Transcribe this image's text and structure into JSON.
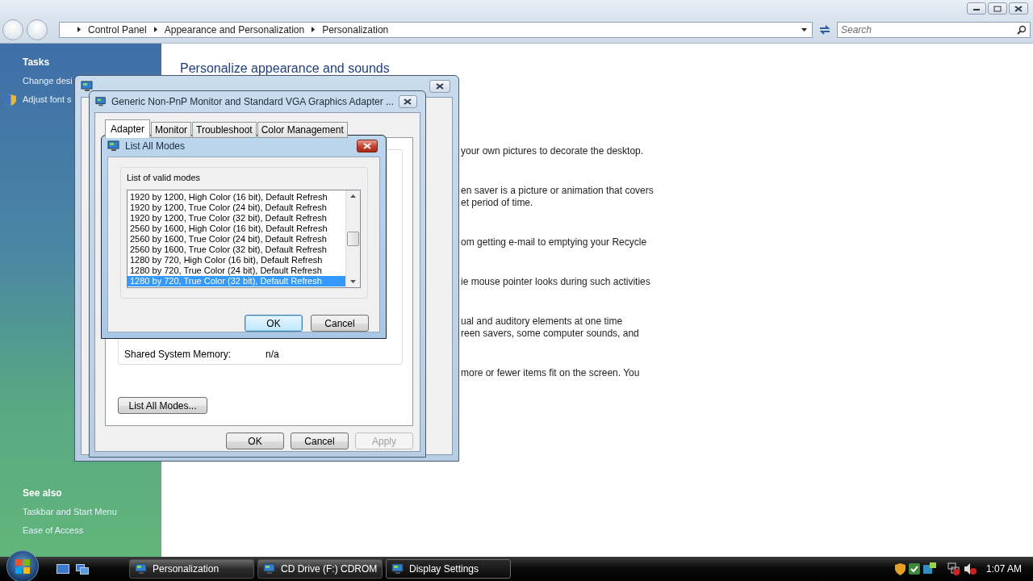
{
  "explorer": {
    "address_bar": {
      "breadcrumbs": [
        "Control Panel",
        "Appearance and Personalization",
        "Personalization"
      ]
    },
    "search": {
      "placeholder": "Search"
    },
    "sidebar": {
      "tasks_heading": "Tasks",
      "tasks": [
        {
          "label": "Change desi",
          "shield": false
        },
        {
          "label": "Adjust font s",
          "shield": true
        }
      ],
      "see_also_heading": "See also",
      "see_also": [
        "Taskbar and Start Menu",
        "Ease of Access"
      ]
    },
    "content": {
      "heading": "Personalize appearance and sounds",
      "descriptions": [
        {
          "lines": [
            "your own pictures to decorate the desktop."
          ]
        },
        {
          "lines": [
            "en saver is a picture or animation that covers",
            "et period of time."
          ]
        },
        {
          "lines": [
            "om getting e-mail to emptying your Recycle"
          ]
        },
        {
          "lines": [
            "ie mouse pointer looks during such activities"
          ]
        },
        {
          "lines": [
            "ual and auditory elements at one time",
            "reen savers, some computer sounds, and"
          ]
        },
        {
          "lines": [
            "more or fewer items fit on the screen. You"
          ]
        }
      ]
    }
  },
  "adapter_window": {
    "title": "Generic Non-PnP Monitor and Standard VGA Graphics Adapter ...",
    "tabs": [
      {
        "label": "Adapter",
        "selected": true
      },
      {
        "label": "Monitor",
        "selected": false
      },
      {
        "label": "Troubleshoot",
        "selected": false
      },
      {
        "label": "Color Management",
        "selected": false
      }
    ],
    "shared_memory": {
      "label": "Shared System Memory:",
      "value": "n/a"
    },
    "list_all_modes_button": "List All Modes...",
    "buttons": [
      {
        "label": "OK",
        "disabled": false
      },
      {
        "label": "Cancel",
        "disabled": false
      },
      {
        "label": "Apply",
        "disabled": true
      }
    ]
  },
  "list_modes_dialog": {
    "title": "List All Modes",
    "group_label": "List of valid modes",
    "modes": [
      {
        "label": "1920 by 1200, High Color (16 bit), Default Refresh",
        "selected": false
      },
      {
        "label": "1920 by 1200, True Color (24 bit), Default Refresh",
        "selected": false
      },
      {
        "label": "1920 by 1200, True Color (32 bit), Default Refresh",
        "selected": false
      },
      {
        "label": "2560 by 1600, High Color (16 bit), Default Refresh",
        "selected": false
      },
      {
        "label": "2560 by 1600, True Color (24 bit), Default Refresh",
        "selected": false
      },
      {
        "label": "2560 by 1600, True Color (32 bit), Default Refresh",
        "selected": false
      },
      {
        "label": "1280 by 720, High Color (16 bit), Default Refresh",
        "selected": false
      },
      {
        "label": "1280 by 720, True Color (24 bit), Default Refresh",
        "selected": false
      },
      {
        "label": "1280 by 720, True Color (32 bit), Default Refresh",
        "selected": true
      }
    ],
    "buttons": [
      {
        "label": "OK",
        "default": true
      },
      {
        "label": "Cancel",
        "default": false
      }
    ]
  },
  "taskbar": {
    "tasks": [
      {
        "label": "Personalization",
        "active": false
      },
      {
        "label": "CD Drive (F:) CDROM",
        "active": false
      },
      {
        "label": "Display Settings",
        "active": true
      }
    ],
    "clock": "1:07 AM"
  }
}
